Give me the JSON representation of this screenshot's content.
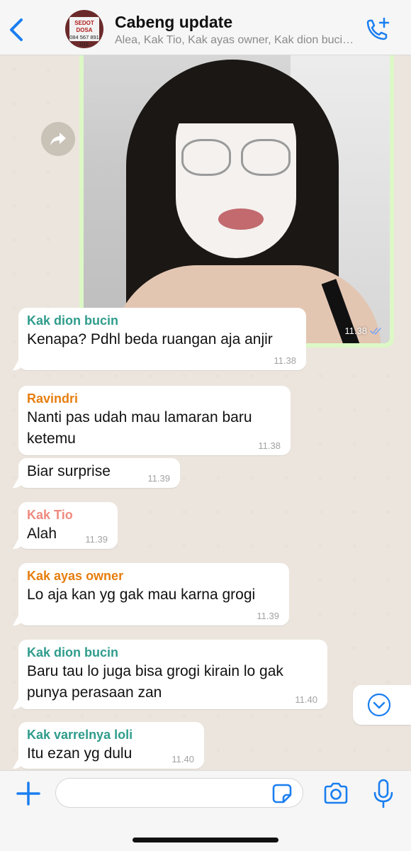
{
  "header": {
    "title": "Cabeng update",
    "subtitle": "Alea, Kak Tio, Kak ayas owner, Kak dion bucin, Kak varrelnya loli, Ravindri",
    "avatar_text_line1": "SEDOT DOSA",
    "avatar_text_line2": "084 567 891 011"
  },
  "colors": {
    "accent": "#1a7ef0",
    "outgoing_bubble": "#dcf8c6",
    "incoming_bubble": "#ffffff",
    "chat_background": "#ece5dd",
    "sender_green": "#2f9c8c",
    "sender_orange": "#e67e10",
    "sender_pink": "#ef8a80",
    "read_ticks": "#7ea6ef"
  },
  "image_message": {
    "time": "11.38",
    "status_icon": "double-check-icon"
  },
  "messages": [
    {
      "sender": "Kak dion bucin",
      "sender_color": "#2f9c8c",
      "text": "Kenapa? Pdhl beda ruangan aja anjir",
      "time": "11.38"
    },
    {
      "sender": "Ravindri",
      "sender_color": "#e67e10",
      "text": "Nanti pas udah mau lamaran baru ketemu",
      "time": "11.38"
    },
    {
      "sender": "",
      "sender_color": "",
      "text": "Biar surprise",
      "time": "11.39"
    },
    {
      "sender": "Kak Tio",
      "sender_color": "#ef8a80",
      "text": "Alah",
      "time": "11.39"
    },
    {
      "sender": "Kak ayas owner",
      "sender_color": "#e67e10",
      "text": "Lo aja kan yg gak mau karna grogi",
      "time": "11.39"
    },
    {
      "sender": "Kak dion bucin",
      "sender_color": "#2f9c8c",
      "text": "Baru tau lo juga bisa grogi kirain lo gak punya perasaan zan",
      "time": "11.40"
    },
    {
      "sender": "Kak varrelnya loli",
      "sender_color": "#2f9c8c",
      "text": "Itu ezan yg dulu",
      "time": "11.40"
    }
  ],
  "composer": {
    "placeholder": "",
    "value": ""
  }
}
